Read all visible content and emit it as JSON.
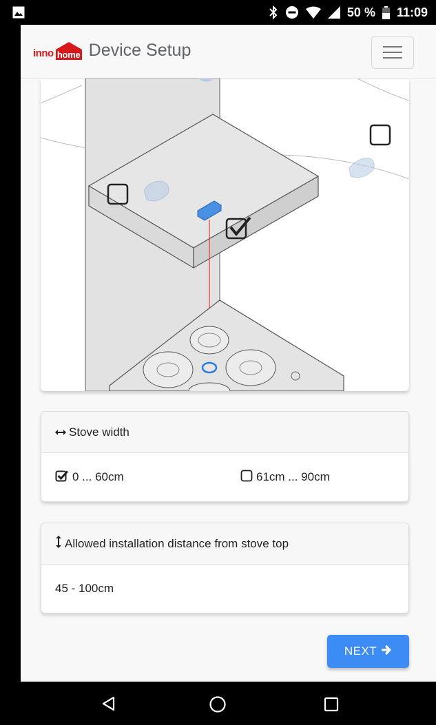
{
  "status_bar": {
    "battery": "50 %",
    "time": "11:09"
  },
  "navbar": {
    "logo_part1": "inno",
    "logo_part2": "home",
    "title": "Device Setup"
  },
  "stove_width": {
    "title": "Stove width",
    "options": [
      {
        "label": "0 ... 60cm",
        "checked": true
      },
      {
        "label": "61cm ... 90cm",
        "checked": false
      }
    ]
  },
  "distance": {
    "title": "Allowed installation distance from stove top",
    "value": "45 - 100cm"
  },
  "next_button": {
    "label": "NEXT"
  },
  "colors": {
    "accent": "#3d8cf5",
    "brand": "#d7191c",
    "sensor_blue": "#4a90e2",
    "laser": "#e53935"
  }
}
